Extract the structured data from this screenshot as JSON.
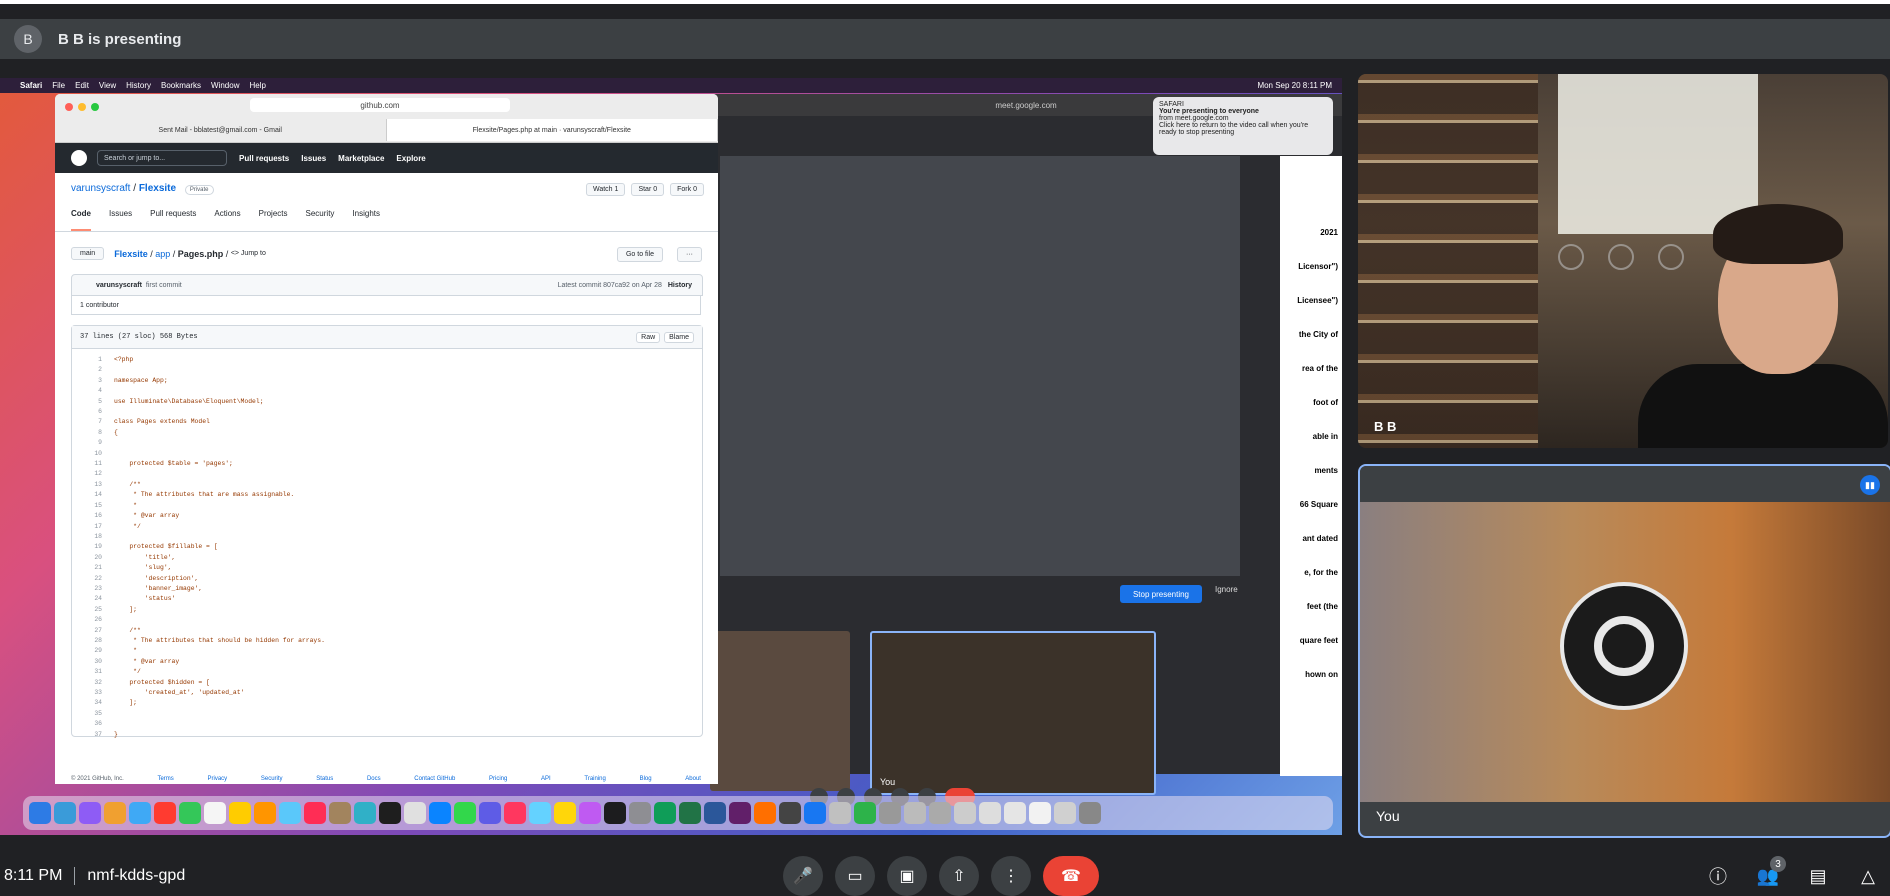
{
  "presenting_bar": {
    "avatar_letter": "B",
    "text": "B B is presenting"
  },
  "shared_screen": {
    "menubar": {
      "apple": "",
      "app": "Safari",
      "items": [
        "File",
        "Edit",
        "View",
        "History",
        "Bookmarks",
        "Window",
        "Help"
      ],
      "clock": "Mon Sep 20  8:11 PM"
    },
    "github_window": {
      "url": "github.com",
      "tabs": [
        "Sent Mail - bblatest@gmail.com - Gmail",
        "Flexsite/Pages.php at main · varunsyscraft/Flexsite"
      ],
      "header": {
        "search_placeholder": "Search or jump to...",
        "nav": [
          "Pull requests",
          "Issues",
          "Marketplace",
          "Explore"
        ]
      },
      "repo": {
        "owner": "varunsyscraft",
        "name": "Flexsite",
        "visibility": "Private",
        "actions": [
          "Watch",
          "1",
          "Star",
          "0",
          "Fork",
          "0"
        ]
      },
      "tabs_nav": [
        "Code",
        "Issues",
        "Pull requests",
        "Actions",
        "Projects",
        "Security",
        "Insights"
      ],
      "path": {
        "branch": "main",
        "parts": [
          "Flexsite",
          "app",
          "Pages.php"
        ],
        "jump": "<> Jump to",
        "goto": "Go to file",
        "more": "···"
      },
      "commit": {
        "user": "varunsyscraft",
        "message": "first commit",
        "latest": "Latest commit 807ca92 on Apr 28",
        "history": "History"
      },
      "contributors": "1 contributor",
      "file_info": "37 lines (27 sloc)   568 Bytes",
      "file_buttons": [
        "Raw",
        "Blame"
      ],
      "code_lines": [
        "<?php",
        "",
        "namespace App;",
        "",
        "use Illuminate\\Database\\Eloquent\\Model;",
        "",
        "class Pages extends Model",
        "{",
        "",
        "",
        "    protected $table = 'pages';",
        "",
        "    /**",
        "     * The attributes that are mass assignable.",
        "     *",
        "     * @var array",
        "     */",
        "",
        "    protected $fillable = [",
        "        'title',",
        "        'slug',",
        "        'description',",
        "        'banner_image',",
        "        'status'",
        "    ];",
        "",
        "    /**",
        "     * The attributes that should be hidden for arrays.",
        "     *",
        "     * @var array",
        "     */",
        "    protected $hidden = [",
        "        'created_at', 'updated_at'",
        "    ];",
        "",
        "",
        "}"
      ],
      "footer": [
        "© 2021 GitHub, Inc.",
        "Terms",
        "Privacy",
        "Security",
        "Status",
        "Docs",
        "Contact GitHub",
        "Pricing",
        "API",
        "Training",
        "Blog",
        "About"
      ]
    },
    "meet_window": {
      "url": "meet.google.com",
      "notification": {
        "app": "SAFARI",
        "title": "You're presenting to everyone",
        "source": "from meet.google.com",
        "body": "Click here to return to the video call when you're ready to stop presenting"
      },
      "stop_button": "Stop presenting",
      "ignore_button": "Ignore",
      "thumb_label": "You",
      "doc_texts": [
        "2021",
        "Licensor\")",
        "Licensee\")",
        "the City of",
        "rea of the",
        "foot of",
        "able in",
        "ments",
        "66 Square",
        "ant dated",
        "e, for the",
        "feet (the",
        "quare feet",
        "hown on"
      ]
    }
  },
  "tiles": {
    "bb": {
      "label": "B B"
    },
    "you": {
      "label": "You"
    }
  },
  "bottom_bar": {
    "time": "8:11 PM",
    "meeting_code": "nmf-kdds-gpd",
    "people_count": "3"
  },
  "colors": {
    "end_call": "#ea4335",
    "accent": "#1a73e8",
    "speaking_border": "#8ab4f8",
    "background": "#202124"
  }
}
